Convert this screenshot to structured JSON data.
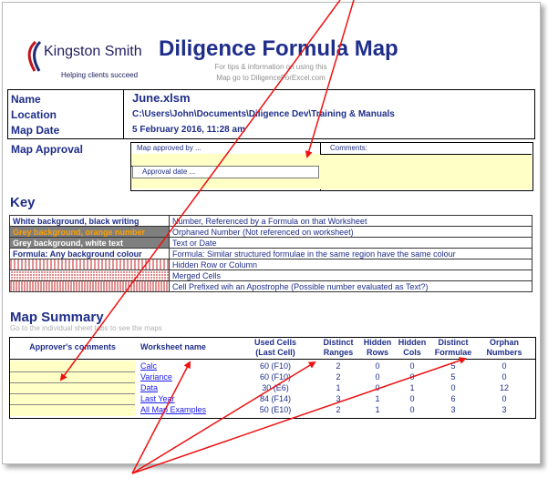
{
  "logo": {
    "name": "Kingston Smith",
    "tagline": "Helping clients succeed"
  },
  "header": {
    "title": "Diligence Formula Map",
    "tips_line1": "For tips & information on using this",
    "tips_line2": "Map go to DiligenceForExcel.com"
  },
  "info": {
    "name_label": "Name",
    "name_value": "June.xlsm",
    "location_label": "Location",
    "location_value": "C:\\Users\\John\\Documents\\Diligence Dev\\Training & Manuals",
    "mapdate_label": "Map Date",
    "mapdate_value": "5 February 2016, 11:28 am"
  },
  "approval": {
    "label": "Map Approval",
    "approved_by_placeholder": "Map approved by ...",
    "approval_date_placeholder": "Approval date ...",
    "comments_label": "Comments:"
  },
  "key": {
    "title": "Key",
    "rows": [
      {
        "swatch": "White background, black writing",
        "desc": "Number, Referenced by a Formula on that Worksheet"
      },
      {
        "swatch": "Grey background, orange number",
        "desc": "Orphaned Number (Not referenced on worksheet)"
      },
      {
        "swatch": "Grey background, white text",
        "desc": "Text or Date"
      },
      {
        "swatch": "Formula: Any background colour",
        "desc": "Formula: Similar structured formulae in the same region have the same colour"
      },
      {
        "swatch": "",
        "desc": "Hidden Row or Column"
      },
      {
        "swatch": "",
        "desc": "Merged Cells"
      },
      {
        "swatch": "",
        "desc": "Cell Prefixed wih an Apostrophe (Possible number evaluated as Text?)"
      }
    ]
  },
  "summary": {
    "title": "Map Summary",
    "subtitle": "Go to the individual sheet tabs to see the maps",
    "headers": {
      "comments": "Approver's comments",
      "worksheet": "Worksheet name",
      "used1": "Used Cells",
      "used2": "(Last Cell)",
      "ranges1": "Distinct",
      "ranges2": "Ranges",
      "hrows1": "Hidden",
      "hrows2": "Rows",
      "hcols1": "Hidden",
      "hcols2": "Cols",
      "formulae1": "Distinct",
      "formulae2": "Formulae",
      "orphan1": "Orphan",
      "orphan2": "Numbers"
    },
    "rows": [
      {
        "name": "Calc",
        "used": "60 (F10)",
        "ranges": "2",
        "hrows": "0",
        "hcols": "0",
        "formulae": "5",
        "orphans": "0"
      },
      {
        "name": "Variance",
        "used": "60 (F10)",
        "ranges": "2",
        "hrows": "0",
        "hcols": "0",
        "formulae": "5",
        "orphans": "0"
      },
      {
        "name": "Data",
        "used": "30 (E6)",
        "ranges": "1",
        "hrows": "0",
        "hcols": "1",
        "formulae": "0",
        "orphans": "12"
      },
      {
        "name": "Last Year",
        "used": "84 (F14)",
        "ranges": "3",
        "hrows": "1",
        "hcols": "0",
        "formulae": "6",
        "orphans": "0"
      },
      {
        "name": "All Map Examples",
        "used": "50 (E10)",
        "ranges": "2",
        "hrows": "1",
        "hcols": "0",
        "formulae": "3",
        "orphans": "3"
      }
    ]
  },
  "colors": {
    "title": "#1f2e8a",
    "yellow": "#ffffc6",
    "arrow": "#ee1111"
  }
}
